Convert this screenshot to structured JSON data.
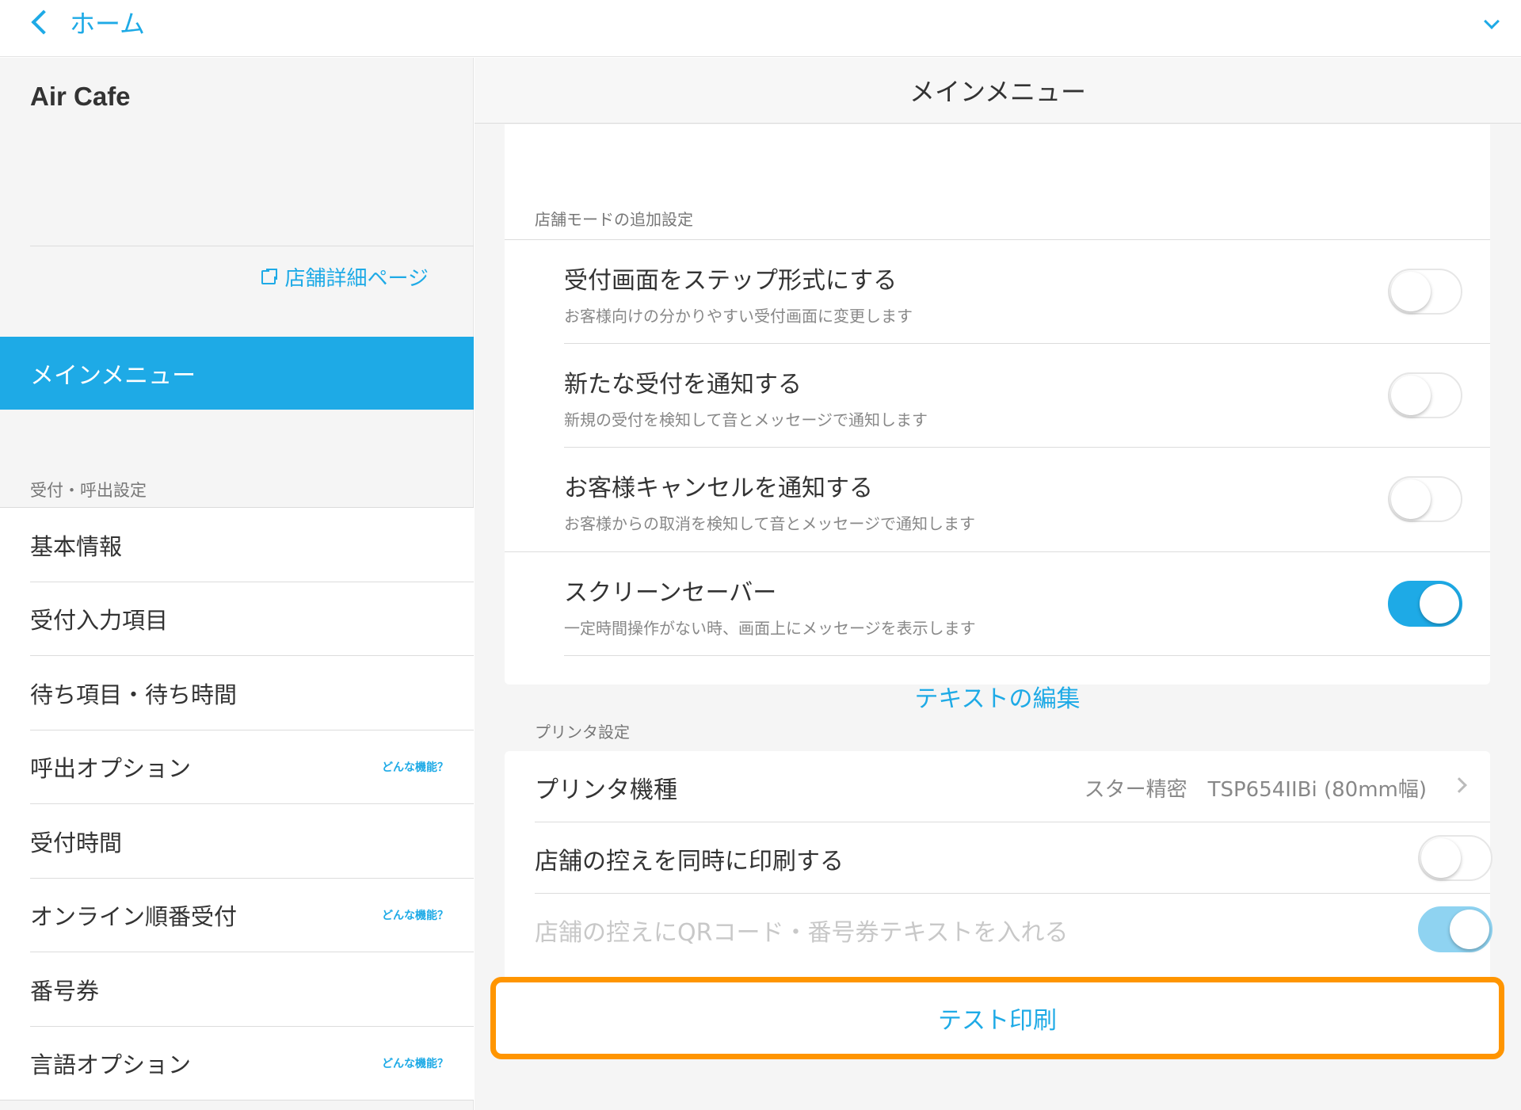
{
  "topbar": {
    "back_label": "ホーム"
  },
  "sidebar": {
    "store_name": "Air Cafe",
    "store_link": "店舗詳細ページ",
    "active_item": "メインメニュー",
    "section_title": "受付・呼出設定",
    "items": [
      {
        "label": "基本情報",
        "help": ""
      },
      {
        "label": "受付入力項目",
        "help": ""
      },
      {
        "label": "待ち項目・待ち時間",
        "help": ""
      },
      {
        "label": "呼出オプション",
        "help": "どんな機能？"
      },
      {
        "label": "受付時間",
        "help": ""
      },
      {
        "label": "オンライン順番受付",
        "help": "どんな機能？"
      },
      {
        "label": "番号券",
        "help": ""
      },
      {
        "label": "言語オプション",
        "help": "どんな機能？"
      }
    ]
  },
  "main": {
    "title": "メインメニュー",
    "store_mode": {
      "section_title": "店舗モードの追加設定",
      "rows": [
        {
          "title": "受付画面をステップ形式にする",
          "desc": "お客様向けの分かりやすい受付画面に変更します",
          "on": false
        },
        {
          "title": "新たな受付を通知する",
          "desc": "新規の受付を検知して音とメッセージで通知します",
          "on": false
        },
        {
          "title": "お客様キャンセルを通知する",
          "desc": "お客様からの取消を検知して音とメッセージで通知します",
          "on": false
        },
        {
          "title": "スクリーンセーバー",
          "desc": "一定時間操作がない時、画面上にメッセージを表示します",
          "on": true
        }
      ],
      "edit_text": "テキストの編集"
    },
    "printer": {
      "section_title": "プリンタ設定",
      "model_label": "プリンタ機種",
      "model_value": "スター精密　TSP654IIBi (80mm幅)",
      "copy_label": "店舗の控えを同時に印刷する",
      "copy_on": false,
      "qr_label": "店舗の控えにQRコード・番号券テキストを入れる",
      "qr_on": true
    },
    "test_print": "テスト印刷"
  },
  "colors": {
    "accent": "#1eaae6",
    "highlight": "#ff9500"
  }
}
